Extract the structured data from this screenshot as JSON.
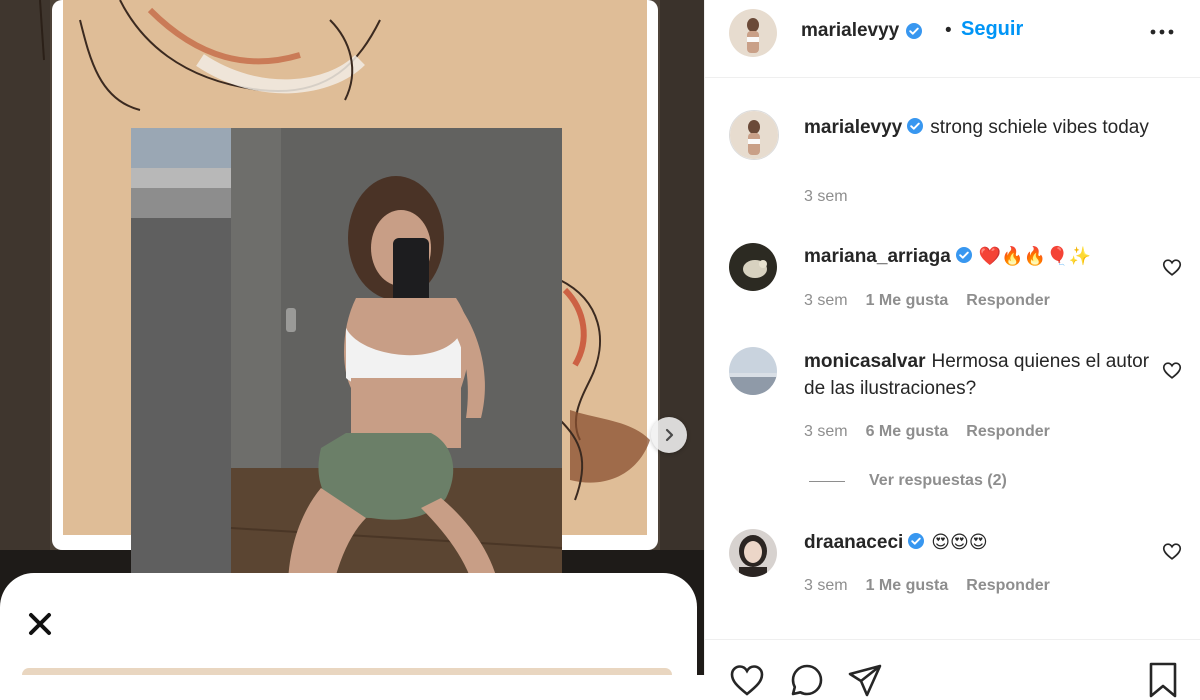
{
  "post": {
    "author": {
      "username": "marialevyy",
      "verified": true,
      "follow_label": "Seguir",
      "separator": "•"
    },
    "caption": {
      "username": "marialevyy",
      "text": "strong schiele vibes today",
      "time": "3 sem"
    },
    "comments": [
      {
        "username": "mariana_arriaga",
        "verified": true,
        "text": "❤️🔥🔥🎈✨",
        "time": "3 sem",
        "likes": "1 Me gusta",
        "reply_label": "Responder"
      },
      {
        "username": "monicasalvar",
        "verified": false,
        "text": "Hermosa quienes el autor de las ilustraciones?",
        "time": "3 sem",
        "likes": "6 Me gusta",
        "reply_label": "Responder",
        "view_replies": "Ver respuestas (2)"
      },
      {
        "username": "draanaceci",
        "verified": true,
        "text": "😍😍😍",
        "time": "3 sem",
        "likes": "1 Me gusta",
        "reply_label": "Responder"
      }
    ]
  },
  "icons": {
    "verified": "verified-badge-icon",
    "more": "more-options-icon",
    "heart": "heart-icon",
    "comment": "comment-icon",
    "share": "send-icon",
    "save": "bookmark-icon",
    "next": "chevron-right-icon",
    "close": "close-icon"
  },
  "colors": {
    "link_blue": "#0095f6",
    "verified_blue": "#3897f0",
    "muted_text": "#8e8e8e",
    "text": "#262626"
  }
}
